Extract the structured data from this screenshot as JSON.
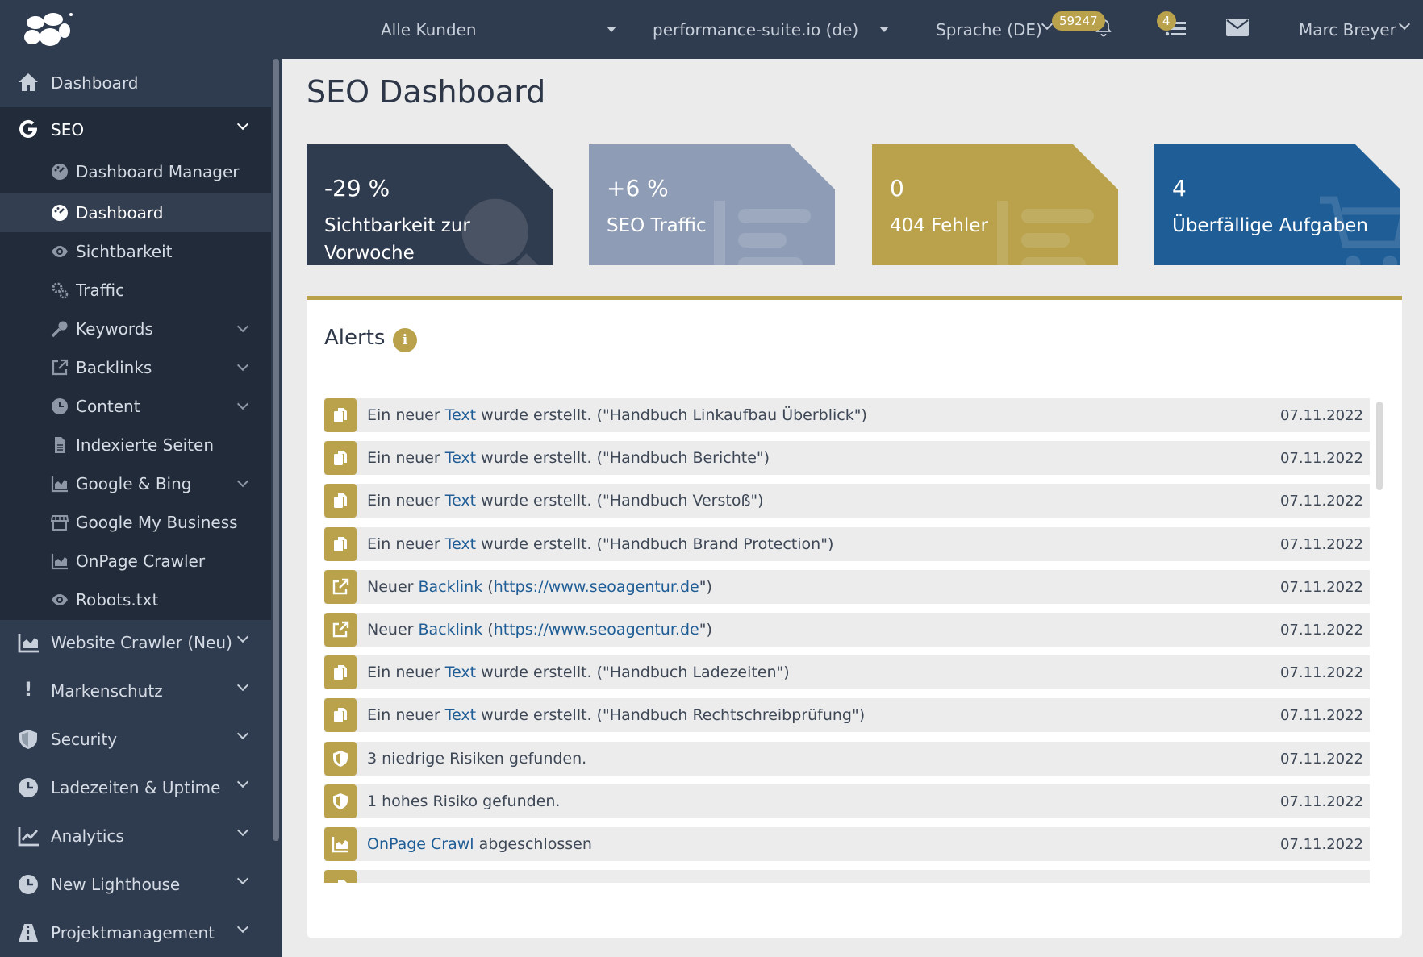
{
  "topbar": {
    "customer_select": "Alle Kunden",
    "domain_select": "performance-suite.io (de)",
    "language_select": "Sprache (DE)",
    "notification_count": "59247",
    "task_count": "4",
    "user_name": "Marc Breyer"
  },
  "sidebar": {
    "items": [
      {
        "label": "Dashboard"
      },
      {
        "label": "SEO"
      },
      {
        "label": "Website Crawler (Neu)"
      },
      {
        "label": "Markenschutz"
      },
      {
        "label": "Security"
      },
      {
        "label": "Ladezeiten & Uptime"
      },
      {
        "label": "Analytics"
      },
      {
        "label": "New Lighthouse"
      },
      {
        "label": "Projektmanagement"
      }
    ],
    "seo_sub": [
      {
        "label": "Dashboard Manager"
      },
      {
        "label": "Dashboard"
      },
      {
        "label": "Sichtbarkeit"
      },
      {
        "label": "Traffic"
      },
      {
        "label": "Keywords"
      },
      {
        "label": "Backlinks"
      },
      {
        "label": "Content"
      },
      {
        "label": "Indexierte Seiten"
      },
      {
        "label": "Google & Bing"
      },
      {
        "label": "Google My Business"
      },
      {
        "label": "OnPage Crawler"
      },
      {
        "label": "Robots.txt"
      }
    ]
  },
  "page": {
    "title": "SEO Dashboard"
  },
  "cards": [
    {
      "value": "-29 %",
      "label_line1": "Sichtbarkeit zur",
      "label_line2": "Vorwoche",
      "color": "#2f3b4e"
    },
    {
      "value": "+6 %",
      "label_line1": "SEO Traffic",
      "label_line2": "",
      "color": "#8e9db5"
    },
    {
      "value": "0",
      "label_line1": "404 Fehler",
      "label_line2": "",
      "color": "#b9a24b"
    },
    {
      "value": "4",
      "label_line1": "Überfällige Aufgaben",
      "label_line2": "",
      "color": "#1f5d96"
    }
  ],
  "alerts": {
    "title": "Alerts",
    "info_icon": "i",
    "rows": [
      {
        "icon": "copy-icon",
        "pre": "Ein neuer ",
        "link": "Text",
        "post": " wurde erstellt. (\"Handbuch Linkaufbau Überblick\")",
        "date": "07.11.2022"
      },
      {
        "icon": "copy-icon",
        "pre": "Ein neuer ",
        "link": "Text",
        "post": " wurde erstellt. (\"Handbuch Berichte\")",
        "date": "07.11.2022"
      },
      {
        "icon": "copy-icon",
        "pre": "Ein neuer ",
        "link": "Text",
        "post": " wurde erstellt. (\"Handbuch Verstoß\")",
        "date": "07.11.2022"
      },
      {
        "icon": "copy-icon",
        "pre": "Ein neuer ",
        "link": "Text",
        "post": " wurde erstellt. (\"Handbuch Brand Protection\")",
        "date": "07.11.2022"
      },
      {
        "icon": "external-link-icon",
        "pre": "Neuer ",
        "link": "Backlink",
        "post": " (",
        "link2": "https://www.seoagentur.de",
        "post2": "\")",
        "date": "07.11.2022"
      },
      {
        "icon": "external-link-icon",
        "pre": "Neuer ",
        "link": "Backlink",
        "post": " (",
        "link2": "https://www.seoagentur.de",
        "post2": "\")",
        "date": "07.11.2022"
      },
      {
        "icon": "copy-icon",
        "pre": "Ein neuer ",
        "link": "Text",
        "post": " wurde erstellt. (\"Handbuch Ladezeiten\")",
        "date": "07.11.2022"
      },
      {
        "icon": "copy-icon",
        "pre": "Ein neuer ",
        "link": "Text",
        "post": " wurde erstellt. (\"Handbuch Rechtschreibprüfung\")",
        "date": "07.11.2022"
      },
      {
        "icon": "shield-icon",
        "pre": "3 niedrige Risiken gefunden.",
        "link": "",
        "post": "",
        "date": "07.11.2022"
      },
      {
        "icon": "shield-icon",
        "pre": "1 hohes Risiko gefunden.",
        "link": "",
        "post": "",
        "date": "07.11.2022"
      },
      {
        "icon": "chart-icon",
        "pre": "",
        "link": "OnPage Crawl",
        "post": " abgeschlossen",
        "date": "07.11.2022"
      }
    ]
  }
}
